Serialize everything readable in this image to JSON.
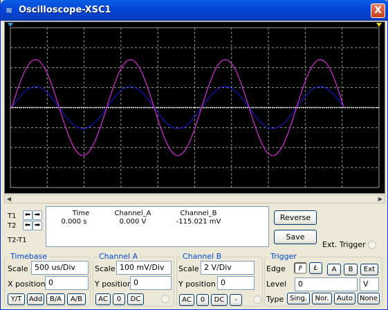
{
  "window": {
    "title": "Oscilloscope-XSC1",
    "close_label": "X"
  },
  "cursors": {
    "t1_label": "T1",
    "t2_label": "T2",
    "diff_label": "T2-T1"
  },
  "readout": {
    "headers": [
      "Time",
      "Channel_A",
      "Channel_B"
    ],
    "values": [
      "0.000 s",
      "0.000 V",
      "-115.021 mV"
    ]
  },
  "buttons": {
    "reverse": "Reverse",
    "save": "Save"
  },
  "ext_trigger": {
    "label": "Ext. Trigger"
  },
  "timebase": {
    "title": "Timebase",
    "scale_label": "Scale",
    "scale_value": "500 us/Div",
    "xpos_label": "X position",
    "xpos_value": "0",
    "modes": [
      "Y/T",
      "Add",
      "B/A",
      "A/B"
    ]
  },
  "channel_a": {
    "title": "Channel A",
    "scale_label": "Scale",
    "scale_value": "100 mV/Div",
    "ypos_label": "Y position",
    "ypos_value": "0",
    "coupling": [
      "AC",
      "0",
      "DC"
    ]
  },
  "channel_b": {
    "title": "Channel B",
    "scale_label": "Scale",
    "scale_value": "2  V/Div",
    "ypos_label": "Y position",
    "ypos_value": "0",
    "coupling": [
      "AC",
      "0",
      "DC",
      "-"
    ]
  },
  "trigger": {
    "title": "Trigger",
    "edge_label": "Edge",
    "edge_rising": "F",
    "edge_falling": "Ł",
    "sources": [
      "A",
      "B",
      "Ext"
    ],
    "level_label": "Level",
    "level_value": "0",
    "level_unit": "V",
    "type_label": "Type",
    "types": [
      "Sing.",
      "Nor.",
      "Auto",
      "None"
    ]
  },
  "scope": {
    "colors": {
      "background": "#000000",
      "grid": "#a0a0a0",
      "channel_a": "#1414c8",
      "channel_b": "#dc28dc",
      "marker": "#ffffff",
      "cursor_t1": "#2ca0e0",
      "cursor_t2": "#e8d020"
    },
    "divisions": {
      "x": 10,
      "y": 8
    },
    "traces": [
      {
        "name": "Channel_A",
        "amplitude_div": 1.05,
        "periods": 3.5
      },
      {
        "name": "Channel_B",
        "amplitude_div": 2.4,
        "periods": 3.5
      }
    ]
  }
}
